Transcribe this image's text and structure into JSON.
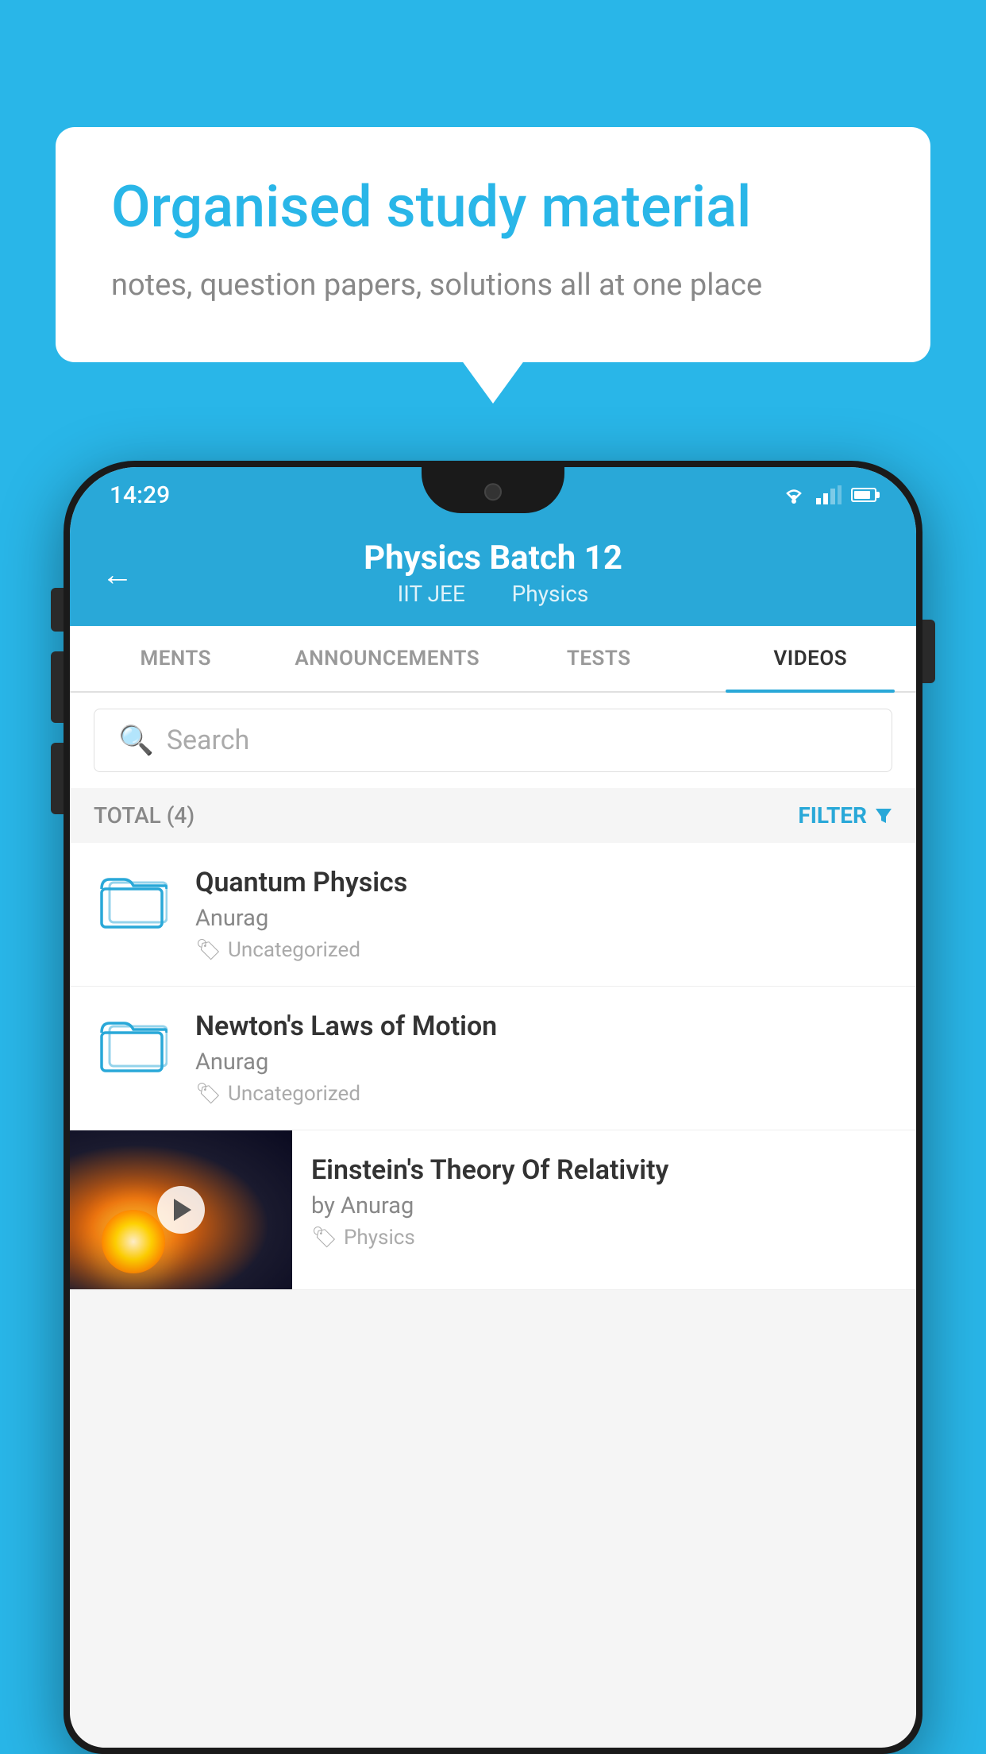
{
  "header": {
    "bubble_title": "Organised study material",
    "bubble_subtitle": "notes, question papers, solutions all at one place"
  },
  "phone": {
    "status_bar": {
      "time": "14:29"
    },
    "app_header": {
      "title": "Physics Batch 12",
      "tag1": "IIT JEE",
      "tag2": "Physics"
    },
    "tabs": [
      {
        "label": "MENTS",
        "active": false
      },
      {
        "label": "ANNOUNCEMENTS",
        "active": false
      },
      {
        "label": "TESTS",
        "active": false
      },
      {
        "label": "VIDEOS",
        "active": true
      }
    ],
    "search": {
      "placeholder": "Search"
    },
    "filter_bar": {
      "total_label": "TOTAL (4)",
      "filter_label": "FILTER"
    },
    "videos": [
      {
        "title": "Quantum Physics",
        "author": "Anurag",
        "tag": "Uncategorized",
        "has_thumbnail": false
      },
      {
        "title": "Newton's Laws of Motion",
        "author": "Anurag",
        "tag": "Uncategorized",
        "has_thumbnail": false
      },
      {
        "title": "Einstein's Theory Of Relativity",
        "author": "by Anurag",
        "tag": "Physics",
        "has_thumbnail": true
      }
    ]
  }
}
